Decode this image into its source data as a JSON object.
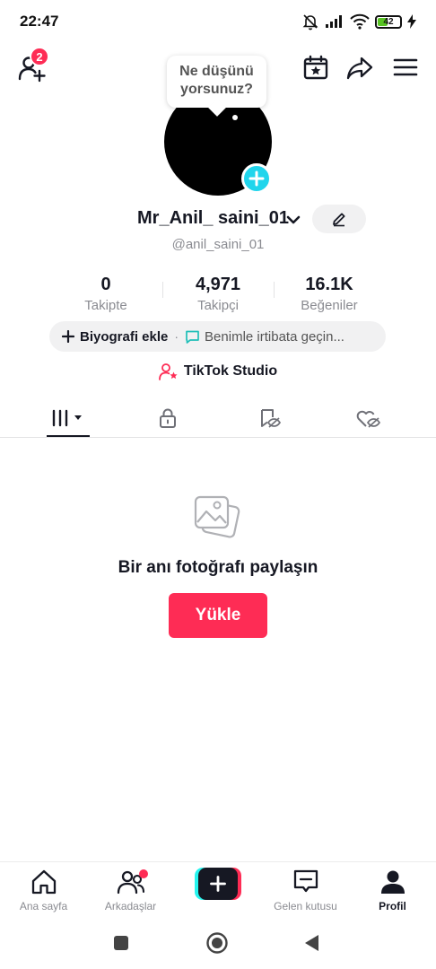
{
  "status_bar": {
    "time": "22:47",
    "battery": "42",
    "battery_level": 0.42
  },
  "top_bar": {
    "friend_requests_badge": "2"
  },
  "profile": {
    "thought_bubble_line1": "Ne düşünü",
    "thought_bubble_line2": "yorsunuz?",
    "display_name": "Mr_Anil_ saini_01",
    "username": "@anil_saini_01"
  },
  "stats": [
    {
      "value": "0",
      "label": "Takipte"
    },
    {
      "value": "4,971",
      "label": "Takipçi"
    },
    {
      "value": "16.1K",
      "label": "Beğeniler"
    }
  ],
  "bio": {
    "add_label": "Biyografi ekle",
    "separator": "·",
    "contact_label": "Benimle irtibata geçin..."
  },
  "studio": {
    "label": "TikTok Studio"
  },
  "empty_state": {
    "title": "Bir anı fotoğrafı paylaşın",
    "button": "Yükle"
  },
  "bottom_nav": [
    {
      "label": "Ana sayfa"
    },
    {
      "label": "Arkadaşlar"
    },
    {
      "label": ""
    },
    {
      "label": "Gelen kutusu"
    },
    {
      "label": "Profil"
    }
  ],
  "colors": {
    "accent": "#fe2c55",
    "cyan": "#25f4ee",
    "avatar_plus": "#20d5ec",
    "text": "#161823",
    "muted": "#8a8b91"
  }
}
